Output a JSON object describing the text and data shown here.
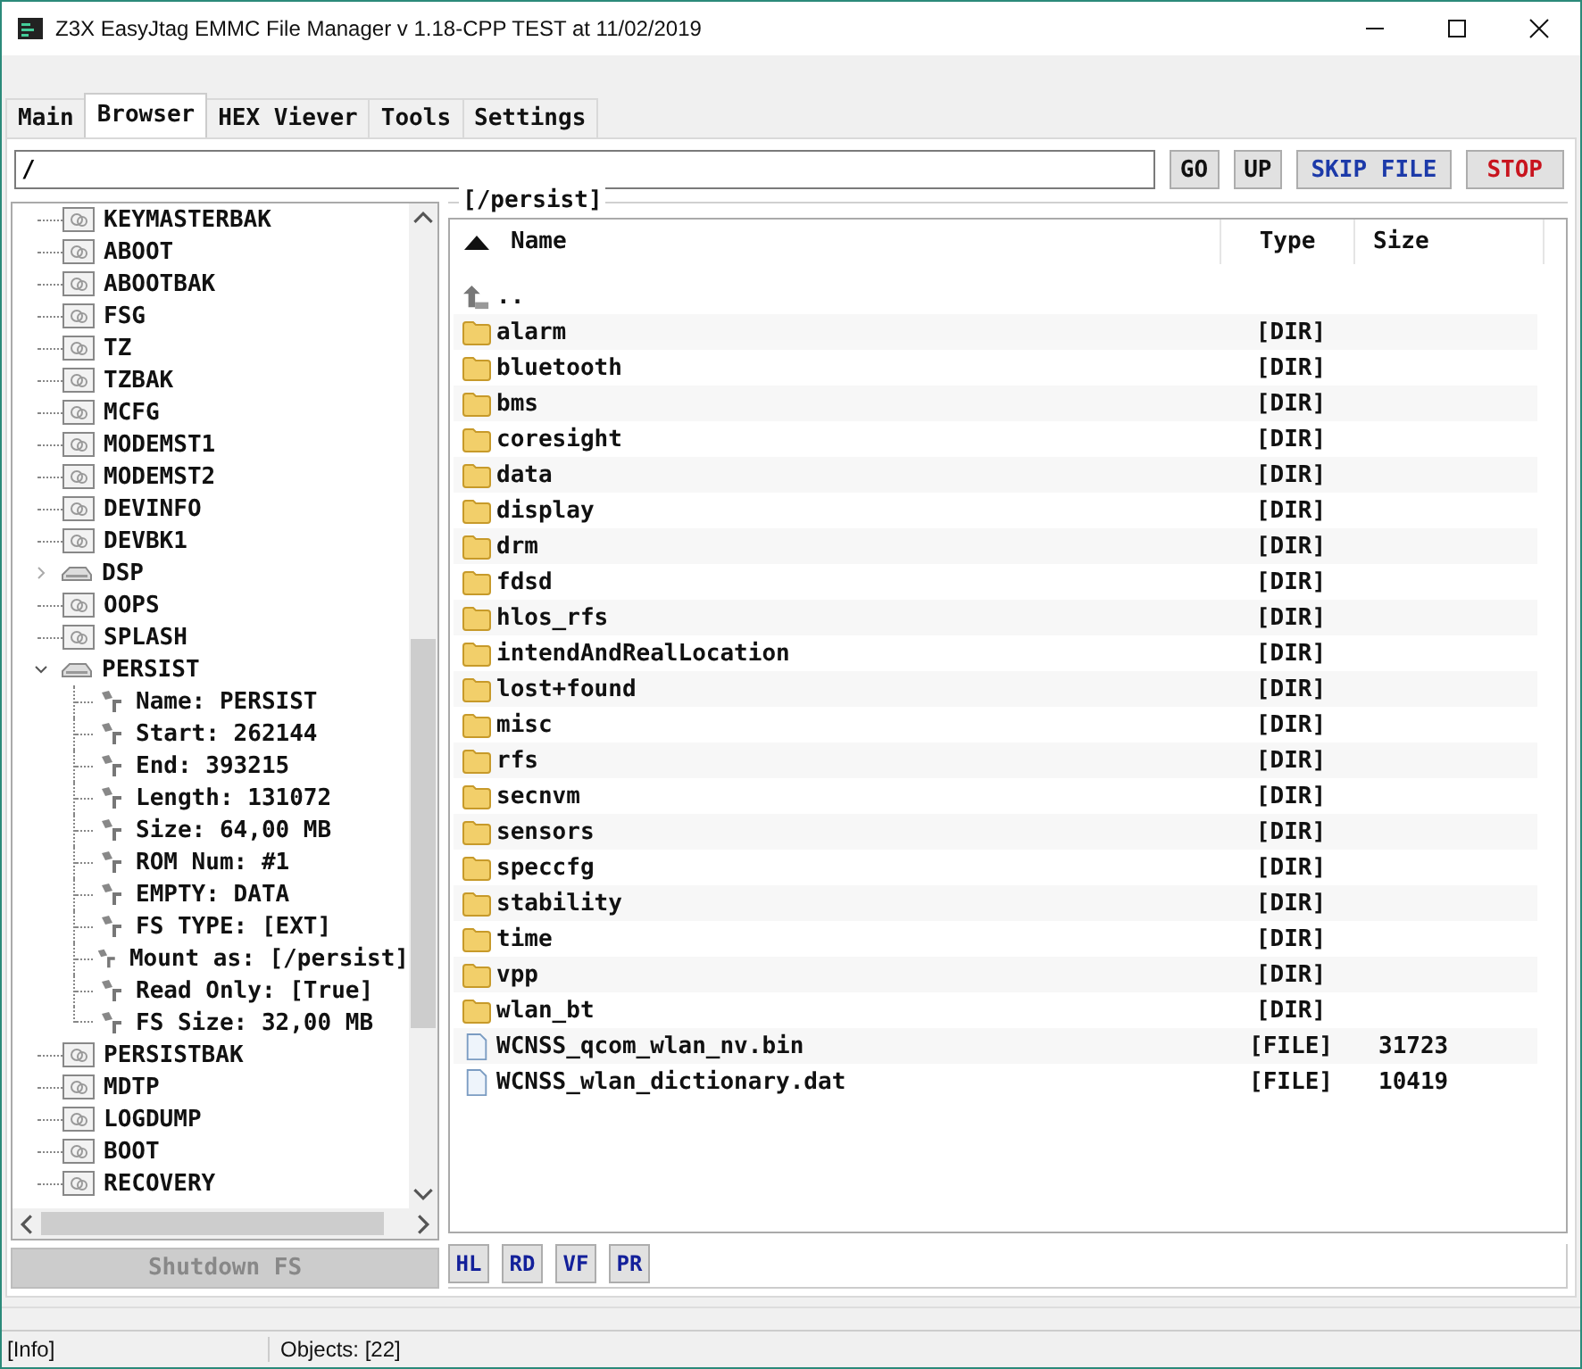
{
  "window": {
    "title": "Z3X EasyJtag EMMC File Manager v 1.18-CPP TEST at 11/02/2019"
  },
  "tabs": [
    {
      "label": "Main",
      "selected": false
    },
    {
      "label": "Browser",
      "selected": true
    },
    {
      "label": "HEX Viever",
      "selected": false
    },
    {
      "label": "Tools",
      "selected": false
    },
    {
      "label": "Settings",
      "selected": false
    }
  ],
  "path_bar": {
    "value": "/",
    "buttons": [
      {
        "label": "GO",
        "kind": "plain"
      },
      {
        "label": "UP",
        "kind": "plain"
      },
      {
        "label": "SKIP FILE",
        "kind": "blue"
      },
      {
        "label": "STOP",
        "kind": "red"
      }
    ]
  },
  "tree": {
    "items": [
      {
        "label": "KEYMASTERBAK",
        "kind": "partition"
      },
      {
        "label": "ABOOT",
        "kind": "partition"
      },
      {
        "label": "ABOOTBAK",
        "kind": "partition"
      },
      {
        "label": "FSG",
        "kind": "partition"
      },
      {
        "label": "TZ",
        "kind": "partition"
      },
      {
        "label": "TZBAK",
        "kind": "partition"
      },
      {
        "label": "MCFG",
        "kind": "partition"
      },
      {
        "label": "MODEMST1",
        "kind": "partition"
      },
      {
        "label": "MODEMST2",
        "kind": "partition"
      },
      {
        "label": "DEVINFO",
        "kind": "partition"
      },
      {
        "label": "DEVBK1",
        "kind": "partition"
      },
      {
        "label": "DSP",
        "kind": "volume",
        "expanded": false
      },
      {
        "label": "OOPS",
        "kind": "partition"
      },
      {
        "label": "SPLASH",
        "kind": "partition"
      },
      {
        "label": "PERSIST",
        "kind": "volume",
        "expanded": true,
        "children": [
          {
            "label": "Name: PERSIST",
            "kind": "property"
          },
          {
            "label": "Start: 262144",
            "kind": "property"
          },
          {
            "label": "End: 393215",
            "kind": "property"
          },
          {
            "label": "Length: 131072",
            "kind": "property"
          },
          {
            "label": "Size: 64,00 MB",
            "kind": "property"
          },
          {
            "label": "ROM Num: #1",
            "kind": "property"
          },
          {
            "label": "EMPTY: DATA",
            "kind": "property"
          },
          {
            "label": "FS TYPE: [EXT]",
            "kind": "property"
          },
          {
            "label": "Mount as: [/persist]",
            "kind": "property"
          },
          {
            "label": "Read Only: [True]",
            "kind": "property"
          },
          {
            "label": "FS Size: 32,00 MB",
            "kind": "property"
          }
        ]
      },
      {
        "label": "PERSISTBAK",
        "kind": "partition"
      },
      {
        "label": "MDTP",
        "kind": "partition"
      },
      {
        "label": "LOGDUMP",
        "kind": "partition"
      },
      {
        "label": "BOOT",
        "kind": "partition"
      },
      {
        "label": "RECOVERY",
        "kind": "partition"
      }
    ],
    "shutdown_button": {
      "label": "Shutdown FS",
      "disabled": true
    }
  },
  "browser": {
    "title": "[/persist]",
    "columns": [
      "Name",
      "Type",
      "Size"
    ],
    "rows": [
      {
        "name": "..",
        "kind": "up"
      },
      {
        "name": "alarm",
        "kind": "dir",
        "type": "[DIR]"
      },
      {
        "name": "bluetooth",
        "kind": "dir",
        "type": "[DIR]"
      },
      {
        "name": "bms",
        "kind": "dir",
        "type": "[DIR]"
      },
      {
        "name": "coresight",
        "kind": "dir",
        "type": "[DIR]"
      },
      {
        "name": "data",
        "kind": "dir",
        "type": "[DIR]"
      },
      {
        "name": "display",
        "kind": "dir",
        "type": "[DIR]"
      },
      {
        "name": "drm",
        "kind": "dir",
        "type": "[DIR]"
      },
      {
        "name": "fdsd",
        "kind": "dir",
        "type": "[DIR]"
      },
      {
        "name": "hlos_rfs",
        "kind": "dir",
        "type": "[DIR]"
      },
      {
        "name": "intendAndRealLocation",
        "kind": "dir",
        "type": "[DIR]"
      },
      {
        "name": "lost+found",
        "kind": "dir",
        "type": "[DIR]"
      },
      {
        "name": "misc",
        "kind": "dir",
        "type": "[DIR]"
      },
      {
        "name": "rfs",
        "kind": "dir",
        "type": "[DIR]"
      },
      {
        "name": "secnvm",
        "kind": "dir",
        "type": "[DIR]"
      },
      {
        "name": "sensors",
        "kind": "dir",
        "type": "[DIR]"
      },
      {
        "name": "speccfg",
        "kind": "dir",
        "type": "[DIR]"
      },
      {
        "name": "stability",
        "kind": "dir",
        "type": "[DIR]"
      },
      {
        "name": "time",
        "kind": "dir",
        "type": "[DIR]"
      },
      {
        "name": "vpp",
        "kind": "dir",
        "type": "[DIR]"
      },
      {
        "name": "wlan_bt",
        "kind": "dir",
        "type": "[DIR]"
      },
      {
        "name": "WCNSS_qcom_wlan_nv.bin",
        "kind": "file",
        "type": "[FILE]",
        "size": "31723"
      },
      {
        "name": "WCNSS_wlan_dictionary.dat",
        "kind": "file",
        "type": "[FILE]",
        "size": "10419"
      }
    ],
    "tool_buttons": [
      "HL",
      "RD",
      "VF",
      "PR"
    ]
  },
  "status_bar": [
    "[Info]",
    "Objects: [22]"
  ]
}
